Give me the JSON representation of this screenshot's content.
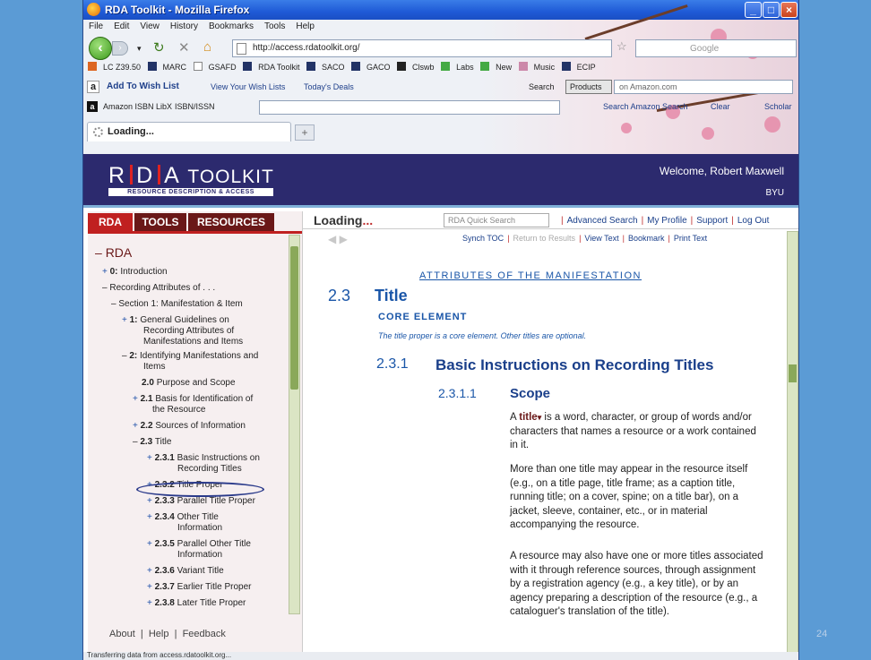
{
  "window": {
    "title": "RDA Toolkit - Mozilla Firefox"
  },
  "menu": [
    "File",
    "Edit",
    "View",
    "History",
    "Bookmarks",
    "Tools",
    "Help"
  ],
  "url": "http://access.rdatoolkit.org/",
  "google_placeholder": "Google",
  "bookmarks": [
    "LC Z39.50",
    "MARC",
    "GSAFD",
    "RDA Toolkit",
    "SACO",
    "GACO",
    "Clswb",
    "Labs",
    "New",
    "Music",
    "ECIP"
  ],
  "amazon_bar": {
    "wish": "Add To Wish List",
    "view": "View Your Wish Lists",
    "deals": "Today's Deals",
    "search": "Search",
    "products": "Products",
    "on_amazon": "on Amazon.com"
  },
  "libx_bar": {
    "isbn": "Amazon ISBN LibX",
    "issn": "ISBN/ISSN",
    "search_amazon": "Search Amazon Search",
    "clear": "Clear",
    "scholar": "Scholar"
  },
  "tab": {
    "label": "Loading..."
  },
  "banner": {
    "logo_r": "R",
    "logo_d": "D",
    "logo_a": "A",
    "logo_toolkit": "TOOLKIT",
    "tagline": "RESOURCE DESCRIPTION & ACCESS",
    "welcome": "Welcome, Robert Maxwell",
    "org": "BYU"
  },
  "left_tabs": [
    "RDA",
    "TOOLS",
    "RESOURCES"
  ],
  "tree": {
    "root": "RDA",
    "n0": "0:",
    "n0t": "Introduction",
    "recording": "Recording Attributes of . . .",
    "section1": "Section 1: Manifestation & Item",
    "n1": "1:",
    "n1t1": "General Guidelines on",
    "n1t2": "Recording Attributes of",
    "n1t3": "Manifestations and Items",
    "n2": "2:",
    "n2t1": "Identifying Manifestations and",
    "n2t2": "Items",
    "n20": "2.0",
    "n20t": "Purpose and Scope",
    "n21": "2.1",
    "n21t1": "Basis for Identification of",
    "n21t2": "the Resource",
    "n22": "2.2",
    "n22t": "Sources of Information",
    "n23": "2.3",
    "n23t": "Title",
    "n231": "2.3.1",
    "n231t1": "Basic Instructions on",
    "n231t2": "Recording Titles",
    "n232": "2.3.2",
    "n232t": "Title Proper",
    "n233": "2.3.3",
    "n233t": "Parallel Title Proper",
    "n234": "2.3.4",
    "n234t1": "Other Title",
    "n234t2": "Information",
    "n235": "2.3.5",
    "n235t1": "Parallel Other Title",
    "n235t2": "Information",
    "n236": "2.3.6",
    "n236t": "Variant Title",
    "n237": "2.3.7",
    "n237t": "Earlier Title Proper",
    "n238": "2.3.8",
    "n238t": "Later Title Proper"
  },
  "left_footer": {
    "about": "About",
    "help": "Help",
    "feedback": "Feedback"
  },
  "right_top": {
    "loading": "Loading",
    "quick_search": "RDA Quick Search",
    "advanced": "Advanced Search",
    "profile": "My Profile",
    "support": "Support",
    "logout": "Log Out",
    "synch": "Synch TOC",
    "return": "Return to Results",
    "view_text": "View Text",
    "bookmark": "Bookmark",
    "print": "Print Text"
  },
  "doc": {
    "attr_heading": "ATTRIBUTES OF THE MANIFESTATION",
    "sec_num": "2.3",
    "sec_title": "Title",
    "core": "CORE ELEMENT",
    "core_note": "The title proper is a core element. Other titles are optional.",
    "sub_num": "2.3.1",
    "sub_title": "Basic Instructions on Recording Titles",
    "subsub_num": "2.3.1.1",
    "subsub_title": "Scope",
    "p1_a": "A ",
    "p1_b": "title",
    "p1_c": " is a word, character, or group of words and/or characters that names a resource or a work contained in it.",
    "p2": "More than one title may appear in the resource itself (e.g., on a title page, title frame; as a caption title, running title; on a cover, spine; on a title bar), on a jacket, sleeve, container, etc., or in material accompanying the resource.",
    "p3": "A resource may also have one or more titles associated with it through reference sources, through assignment by a registration agency (e.g., a key title), or by an agency preparing a description of the resource (e.g., a cataloguer's translation of the title)."
  },
  "status": "Transferring data from access.rdatoolkit.org...",
  "slide_number": "24"
}
